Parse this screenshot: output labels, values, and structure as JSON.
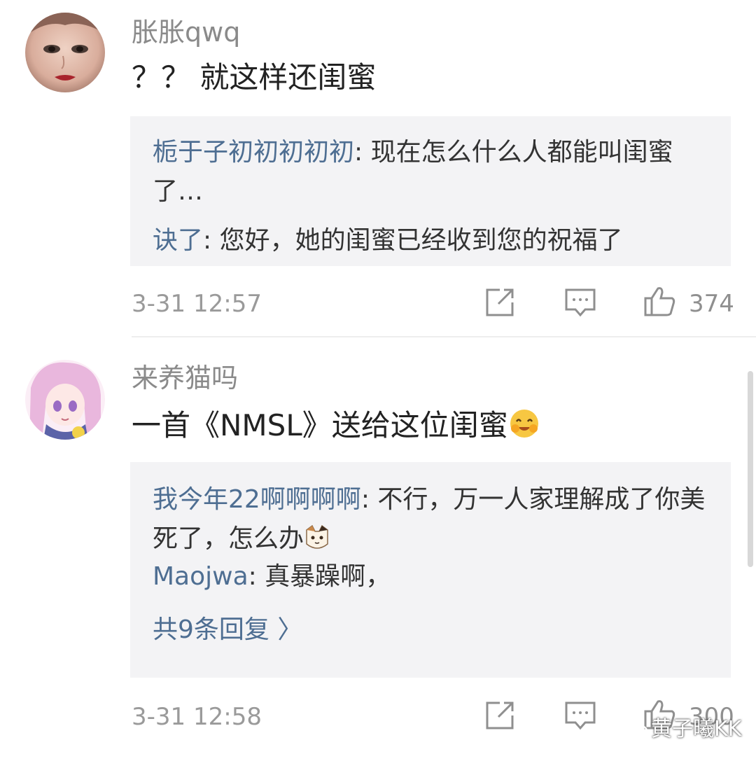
{
  "comments": [
    {
      "username": "胀胀qwq",
      "content": "？？ 就这样还闺蜜",
      "replies": [
        {
          "user": "栀于子初初初初初",
          "sep": ": ",
          "text": "现在怎么什么人都能叫闺蜜了…"
        },
        {
          "user": "诀了",
          "sep": ": ",
          "text": "您好，她的闺蜜已经收到您的祝福了"
        }
      ],
      "time": "3-31 12:57",
      "likes": "374",
      "icons": [
        "share-icon",
        "comment-icon",
        "like-icon"
      ]
    },
    {
      "username": "来养猫吗",
      "content": "一首《NMSL》送给这位闺蜜",
      "content_emoji": "happy-face-emoji",
      "replies": [
        {
          "user": "我今年22啊啊啊啊",
          "sep": ": ",
          "text": "不行，万一人家理解成了你美死了，怎么办",
          "emoji": "cat-face-emoji"
        },
        {
          "user": "Maojwa",
          "sep": ": ",
          "text": "真暴躁啊，"
        }
      ],
      "more_replies": "共9条回复 〉",
      "time": "3-31 12:58",
      "likes": "300",
      "icons": [
        "share-icon",
        "comment-icon",
        "like-icon"
      ]
    }
  ],
  "watermark": "黄子曦KK",
  "colors": {
    "link": "#4e6e92",
    "reply_bg": "#f3f3f5",
    "meta": "#9a9a9a"
  }
}
